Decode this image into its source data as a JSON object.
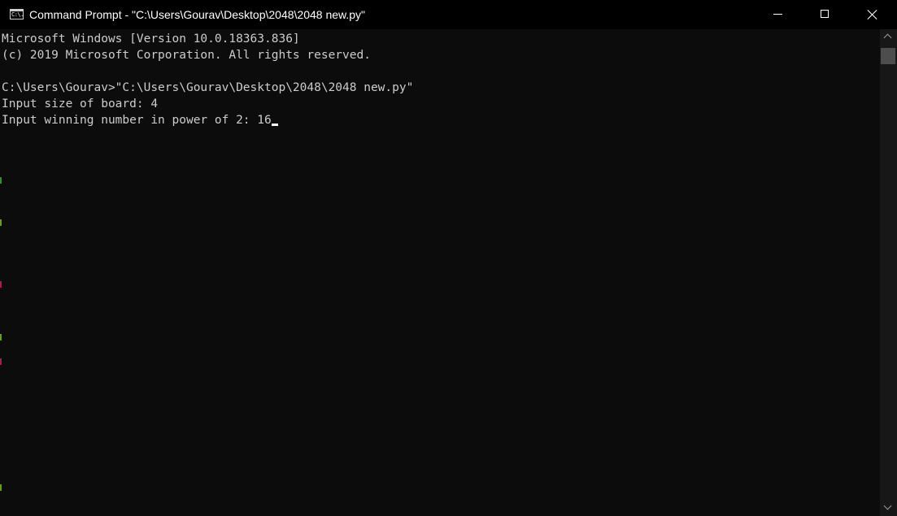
{
  "window": {
    "title": "Command Prompt - \"C:\\Users\\Gourav\\Desktop\\2048\\2048 new.py\"",
    "icon": "cmd-icon",
    "icon_text": "C:\\.",
    "controls": [
      "minimize-icon",
      "maximize-icon",
      "close-icon"
    ]
  },
  "console": {
    "lines": [
      "Microsoft Windows [Version 10.0.18363.836]",
      "(c) 2019 Microsoft Corporation. All rights reserved.",
      "",
      "C:\\Users\\Gourav>\"C:\\Users\\Gourav\\Desktop\\2048\\2048 new.py\"",
      "Input size of board: 4",
      "Input winning number in power of 2: 16"
    ]
  },
  "colors": {
    "background": "#0c0c0c",
    "text": "#cccccc",
    "titlebar": "#000000",
    "scrollbar": "#171717",
    "scroll_thumb": "#4d4d4d"
  }
}
